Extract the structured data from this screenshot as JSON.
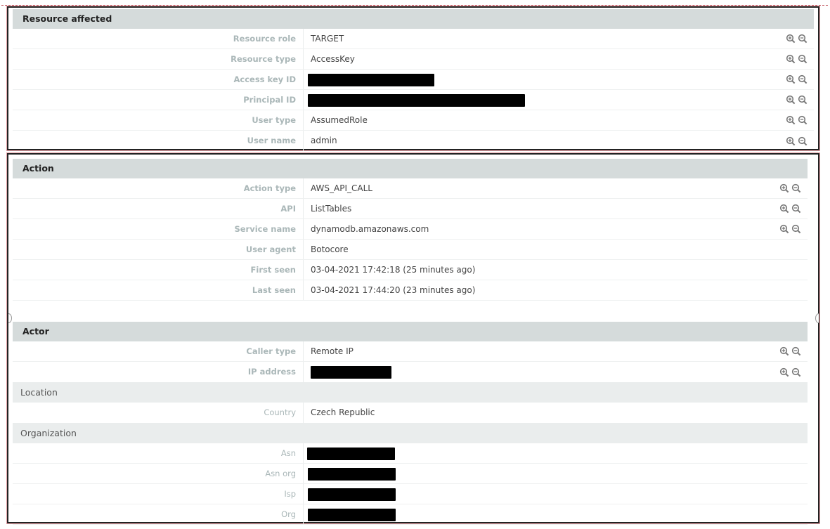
{
  "sections": {
    "resource": {
      "title": "Resource affected",
      "rows": [
        {
          "key": "Resource role",
          "value": "TARGET"
        },
        {
          "key": "Resource type",
          "value": "AccessKey"
        },
        {
          "key": "Access key ID",
          "value": "[REDACTED]"
        },
        {
          "key": "Principal ID",
          "value": "[REDACTED]"
        },
        {
          "key": "User type",
          "value": "AssumedRole"
        },
        {
          "key": "User name",
          "value": "admin"
        }
      ]
    },
    "action": {
      "title": "Action",
      "rows": [
        {
          "key": "Action type",
          "value": "AWS_API_CALL"
        },
        {
          "key": "API",
          "value": "ListTables"
        },
        {
          "key": "Service name",
          "value": "dynamodb.amazonaws.com"
        },
        {
          "key": "User agent",
          "value": "Botocore"
        },
        {
          "key": "First seen",
          "value": "03-04-2021 17:42:18 (25 minutes ago)"
        },
        {
          "key": "Last seen",
          "value": "03-04-2021 17:44:20 (23 minutes ago)"
        }
      ]
    },
    "actor": {
      "title": "Actor",
      "rows": [
        {
          "key": "Caller type",
          "value": "Remote IP"
        },
        {
          "key": "IP address",
          "value": "[REDACTED]"
        }
      ],
      "location": {
        "title": "Location",
        "rows": [
          {
            "key": "Country",
            "value": "Czech Republic"
          }
        ]
      },
      "organization": {
        "title": "Organization",
        "rows": [
          {
            "key": "Asn",
            "value": "[REDACTED]"
          },
          {
            "key": "Asn org",
            "value": "[REDACTED]"
          },
          {
            "key": "Isp",
            "value": "[REDACTED]"
          },
          {
            "key": "Org",
            "value": "[REDACTED]"
          }
        ]
      }
    }
  },
  "icons": {
    "filter_in": "zoom-in-icon",
    "filter_out": "zoom-out-icon"
  },
  "colors": {
    "section_header_bg": "#d5dbdb",
    "sub_header_bg": "#eaeded",
    "key_text": "#aab7b8",
    "value_text": "#444444",
    "redaction": "#000000"
  }
}
